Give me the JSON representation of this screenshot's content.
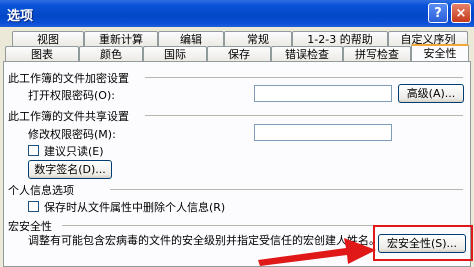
{
  "window": {
    "title": "选项",
    "help_glyph": "?",
    "close_glyph": "×"
  },
  "tabs_row1": [
    "视图",
    "重新计算",
    "编辑",
    "常规",
    "1-2-3 的帮助",
    "自定义序列"
  ],
  "tabs_row2": [
    "图表",
    "颜色",
    "国际",
    "保存",
    "错误检查",
    "拼写检查",
    "安全性"
  ],
  "active_tab": "安全性",
  "encryption": {
    "section_title": "此工作簿的文件加密设置",
    "open_password_label": "打开权限密码(O):",
    "open_password_value": "",
    "advanced_button": "高级(A)..."
  },
  "sharing": {
    "section_title": "此工作簿的文件共享设置",
    "modify_password_label": "修改权限密码(M):",
    "modify_password_value": "",
    "readonly_label": "建议只读(E)",
    "readonly_checked": false,
    "digital_signature_button": "数字签名(D)..."
  },
  "privacy": {
    "section_title": "个人信息选项",
    "remove_personal_label": "保存时从文件属性中删除个人信息(R)",
    "remove_personal_checked": false
  },
  "macro": {
    "section_title": "宏安全性",
    "description": "调整有可能包含宏病毒的文件的安全级别并指定受信任的宏创建人姓名。",
    "macro_security_button": "宏安全性(S)..."
  },
  "annotation": {
    "color": "#e11818"
  }
}
